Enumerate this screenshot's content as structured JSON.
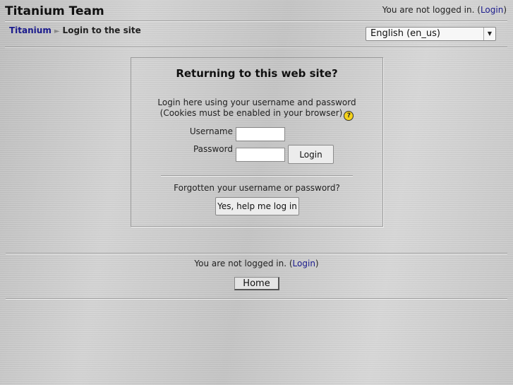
{
  "header": {
    "site_title": "Titanium Team",
    "login_info_prefix": "You are not logged in. (",
    "login_link": "Login",
    "login_info_suffix": ")"
  },
  "navbar": {
    "breadcrumb_home": "Titanium",
    "breadcrumb_separator": "►",
    "breadcrumb_current": "Login to the site",
    "language_selected": "English (en_us)"
  },
  "login_box": {
    "heading": "Returning to this web site?",
    "desc_line1": "Login here using your username and password",
    "desc_line2": "(Cookies must be enabled in your browser)",
    "help_icon_glyph": "?",
    "username_label": "Username",
    "username_value": "",
    "password_label": "Password",
    "password_value": "",
    "login_button": "Login",
    "forgot_text": "Forgotten your username or password?",
    "help_button": "Yes, help me log in"
  },
  "footer": {
    "login_info_prefix": "You are not logged in. (",
    "login_link": "Login",
    "login_info_suffix": ")",
    "home_button": "Home"
  },
  "colors": {
    "link": "#1a1a8c",
    "help_icon": "#f5d21a"
  }
}
